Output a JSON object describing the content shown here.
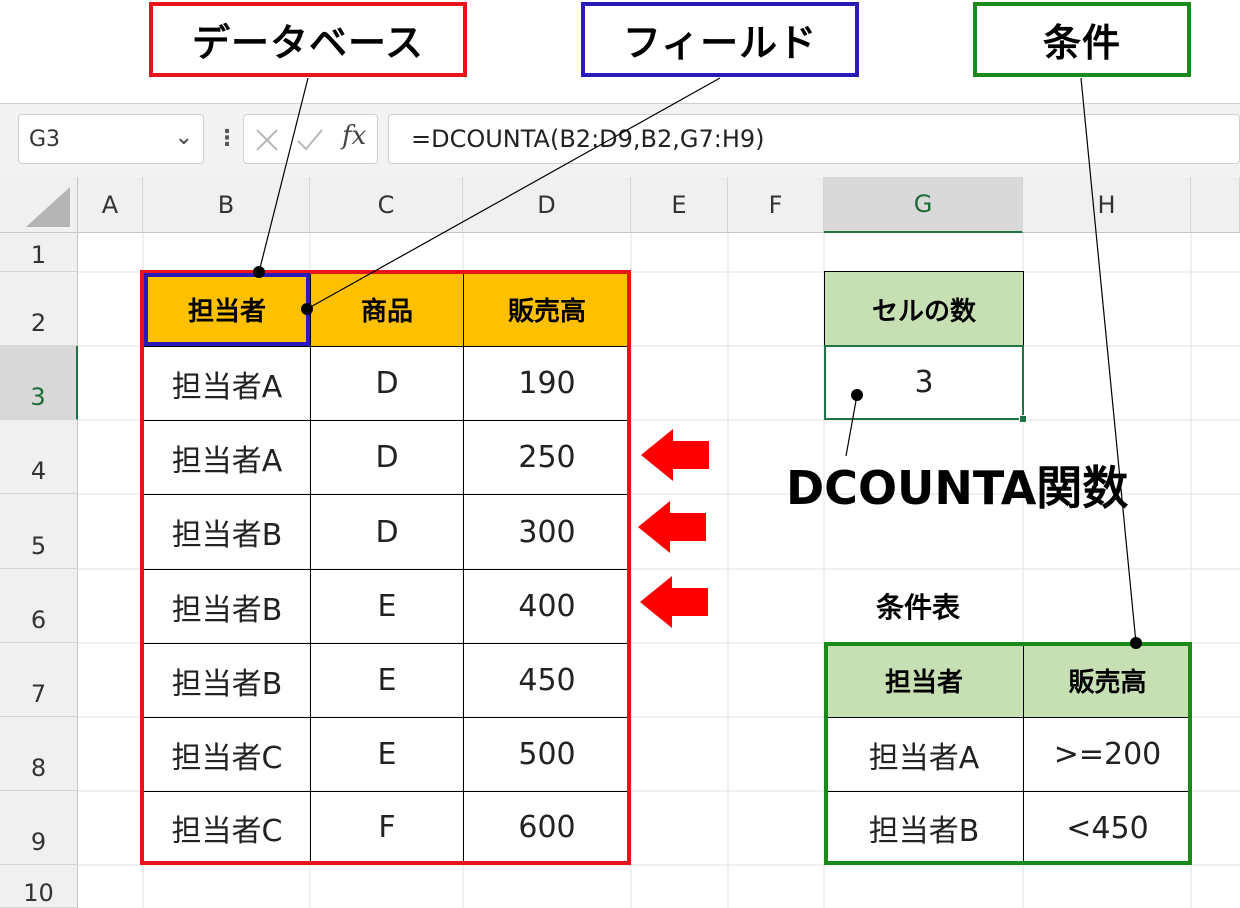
{
  "callouts": {
    "database": "データベース",
    "field": "フィールド",
    "condition": "条件",
    "function": "DCOUNTA関数"
  },
  "colors": {
    "red": "#e8141b",
    "blue": "#2a1ab8",
    "green": "#1a8a1a",
    "header_orange": "#ffc000",
    "header_green": "#c6e0b4",
    "excel_green": "#217346"
  },
  "formula_bar": {
    "name_box": "G3",
    "fx": "fx",
    "formula": "=DCOUNTA(B2:D9,B2,G7:H9)"
  },
  "columns": [
    "A",
    "B",
    "C",
    "D",
    "E",
    "F",
    "G",
    "H"
  ],
  "rows": [
    "1",
    "2",
    "3",
    "4",
    "5",
    "6",
    "7",
    "8",
    "9",
    "10"
  ],
  "database": {
    "headers": [
      "担当者",
      "商品",
      "販売高"
    ],
    "rows": [
      [
        "担当者A",
        "D",
        "190"
      ],
      [
        "担当者A",
        "D",
        "250"
      ],
      [
        "担当者B",
        "D",
        "300"
      ],
      [
        "担当者B",
        "E",
        "400"
      ],
      [
        "担当者B",
        "E",
        "450"
      ],
      [
        "担当者C",
        "E",
        "500"
      ],
      [
        "担当者C",
        "F",
        "600"
      ]
    ]
  },
  "result": {
    "header": "セルの数",
    "value": "3"
  },
  "criteria": {
    "title": "条件表",
    "headers": [
      "担当者",
      "販売高"
    ],
    "rows": [
      [
        "担当者A",
        ">=200"
      ],
      [
        "担当者B",
        "<450"
      ]
    ]
  }
}
